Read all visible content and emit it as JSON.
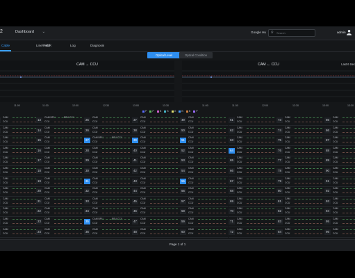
{
  "topbar": {
    "logo": "2",
    "dashboard_label": "Dashboard",
    "google_tag": "Google Hu",
    "search_placeholder": "Search",
    "username": "admin"
  },
  "tabs": [
    {
      "label": "Cable"
    },
    {
      "label": "Line/Field"
    },
    {
      "label": "HDR"
    },
    {
      "label": "Log"
    },
    {
      "label": "Diagnosis"
    }
  ],
  "view_toggle": {
    "active": "Optical Level",
    "inactive": "Optical Condition"
  },
  "charts": [
    {
      "title": "CAM → CCU"
    },
    {
      "title": "CAM ← CCU",
      "right_label": "Last 6 Sec"
    }
  ],
  "time_ticks": [
    "11:00",
    "11:30",
    "12:00",
    "12:30",
    "13:00",
    "13:30",
    "14:00",
    "11:00",
    "11:30",
    "12:00",
    "12:30",
    "13:00",
    "13:30",
    "14:00"
  ],
  "legend": [
    {
      "label": "P",
      "color": "#5b6cff"
    },
    {
      "label": "P",
      "color": "#5fbf5f"
    },
    {
      "label": "B",
      "color": "#d05fcf"
    },
    {
      "label": "B",
      "color": "#44b6c9"
    },
    {
      "label": "G",
      "color": "#e0e070"
    },
    {
      "label": "B",
      "color": "#4aa0ff"
    },
    {
      "label": "B",
      "color": "#d08040"
    },
    {
      "label": "P",
      "color": "#9a6cff"
    }
  ],
  "grid_labels": {
    "cam": "CAM",
    "ccu": "CCU",
    "cam_bpu": "CAM BPU",
    "bpu_ccu": "BPU CCU"
  },
  "columns": [
    {
      "start": 1,
      "hl": []
    },
    {
      "start": 13,
      "hl": []
    },
    {
      "start": 25,
      "hl": [
        27,
        31,
        35
      ]
    },
    {
      "start": 37,
      "hl": [
        39
      ]
    },
    {
      "start": 49,
      "hl": [
        51,
        55
      ]
    },
    {
      "start": 61,
      "hl": [
        64
      ]
    },
    {
      "start": 73,
      "hl": []
    },
    {
      "start": 85,
      "hl": []
    }
  ],
  "footer": {
    "page": "Page 1 of 1"
  }
}
